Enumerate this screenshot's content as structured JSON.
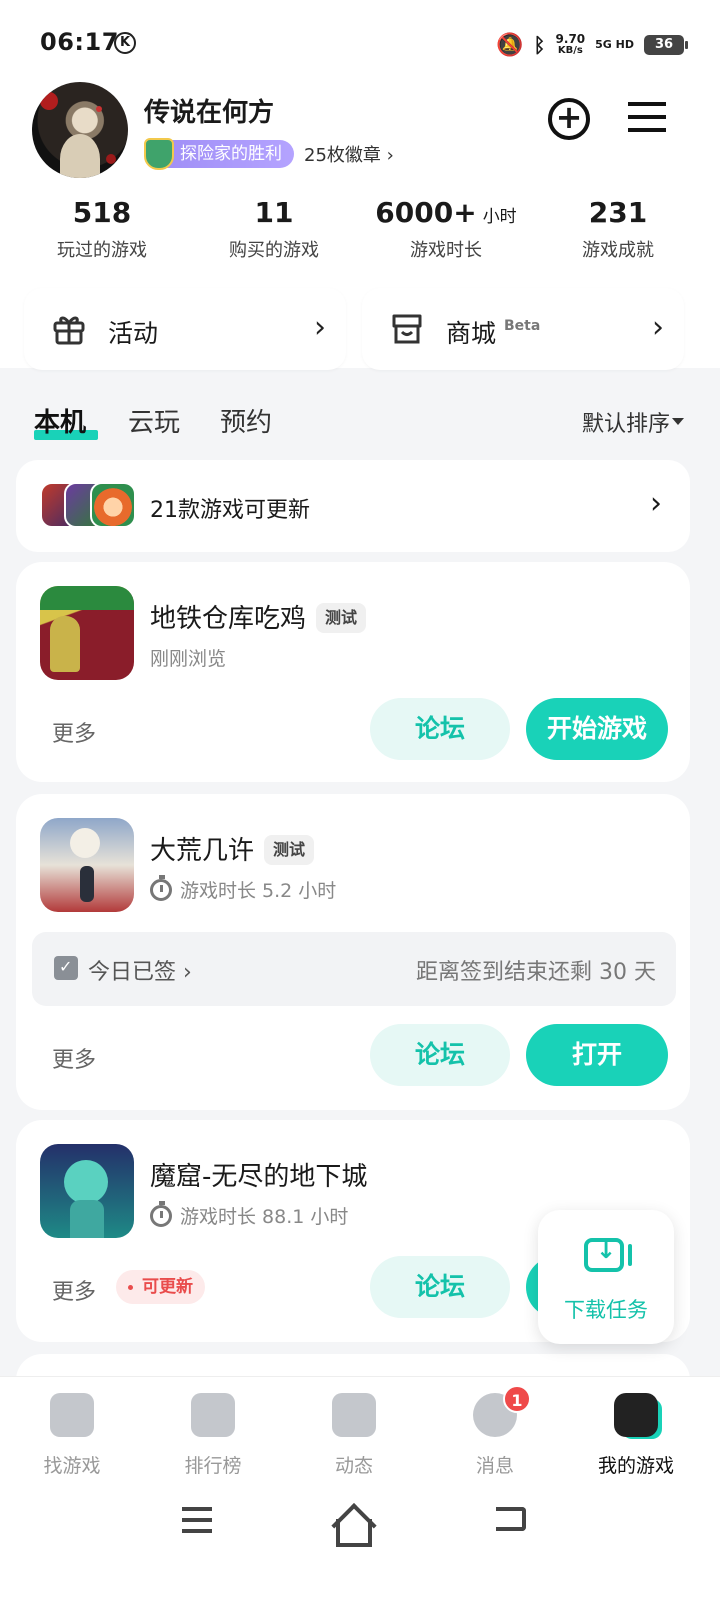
{
  "status": {
    "time": "06:17",
    "k_icon": "K",
    "net_speed": "9.70",
    "net_unit": "KB/s",
    "net_type": "5G HD",
    "battery": "36"
  },
  "profile": {
    "name": "传说在何方",
    "badge_title": "探险家的胜利",
    "badge_count": "25枚徽章 ›",
    "add_icon": "+"
  },
  "stats": [
    {
      "value": "518",
      "unit": "",
      "label": "玩过的游戏"
    },
    {
      "value": "11",
      "unit": "",
      "label": "购买的游戏"
    },
    {
      "value": "6000+",
      "unit": "小时",
      "label": "游戏时长"
    },
    {
      "value": "231",
      "unit": "",
      "label": "游戏成就"
    }
  ],
  "quick": {
    "activity": "活动",
    "mall": "商城",
    "mall_tag": "Beta",
    "arrow": "›"
  },
  "tabs": {
    "local": "本机",
    "cloud": "云玩",
    "reserve": "预约",
    "sort": "默认排序"
  },
  "update_bar": {
    "text": "21款游戏可更新",
    "arrow": "›"
  },
  "games": [
    {
      "title": "地铁仓库吃鸡",
      "tag": "测试",
      "sub": "刚刚浏览",
      "more": "更多",
      "forum": "论坛",
      "action": "开始游戏"
    },
    {
      "title": "大荒几许",
      "tag": "测试",
      "sub": "游戏时长 5.2 小时",
      "checkin": "今日已签 ›",
      "checkin_right": "距离签到结束还剩 30 天",
      "more": "更多",
      "forum": "论坛",
      "action": "打开"
    },
    {
      "title": "魔窟-无尽的地下城",
      "sub": "游戏时长 88.1 小时",
      "more": "更多",
      "update_tag": "可更新",
      "forum": "论坛"
    }
  ],
  "float": {
    "label": "下载任务"
  },
  "nav": [
    {
      "label": "找游戏",
      "icon": "find-game-icon"
    },
    {
      "label": "排行榜",
      "icon": "ranking-icon"
    },
    {
      "label": "动态",
      "icon": "feed-icon"
    },
    {
      "label": "消息",
      "icon": "message-icon",
      "badge": "1"
    },
    {
      "label": "我的游戏",
      "icon": "my-games-icon"
    }
  ],
  "colors": {
    "accent": "#19d2b8",
    "badge": "#9d8cf5",
    "alert": "#ef4a4a"
  }
}
